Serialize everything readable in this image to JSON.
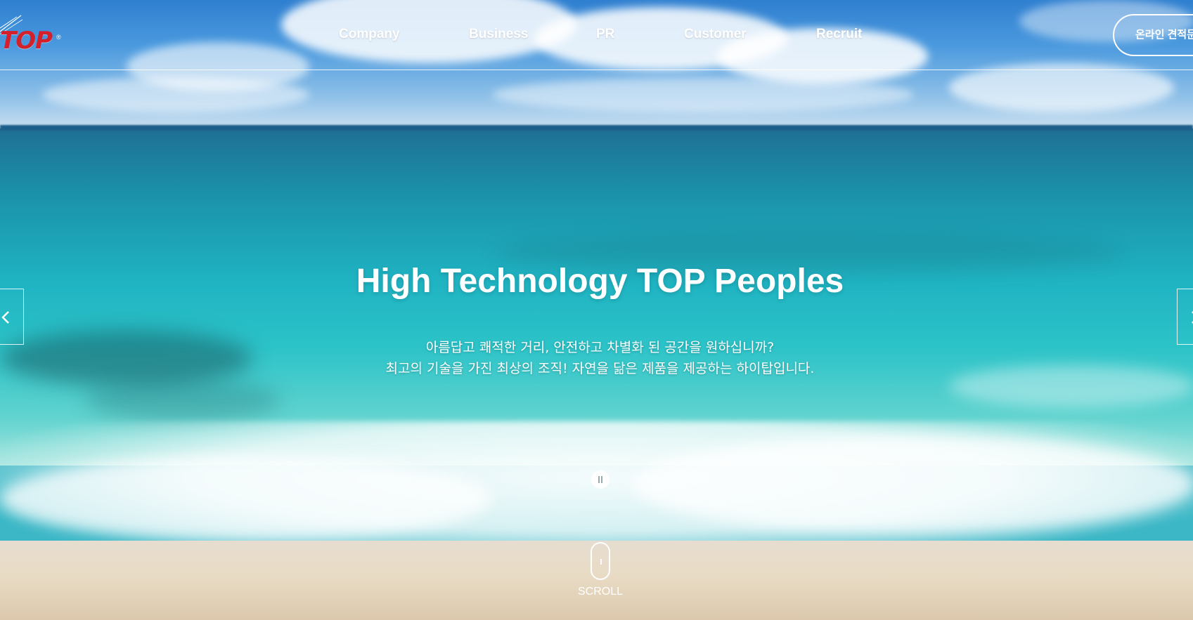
{
  "header": {
    "logo_text": "TOP",
    "logo_mark": "®",
    "nav": [
      {
        "label": "Company"
      },
      {
        "label": "Business"
      },
      {
        "label": "PR"
      },
      {
        "label": "Customer"
      },
      {
        "label": "Recruit"
      }
    ],
    "quote_button_label": "온라인 견적문의"
  },
  "hero": {
    "title": "High Technology TOP Peoples",
    "subtitle_line1": "아름답고 쾌적한 거리, 안전하고 차별화 된 공간을 원하십니까?",
    "subtitle_line2": "최고의 기술을 가진 최상의 조직! 자연을 닮은 제품을 제공하는 하이탑입니다."
  },
  "slider": {
    "prev_icon": "chevron-left-icon",
    "next_icon": "chevron-right-icon",
    "pause_icon": "pause-icon"
  },
  "scroll": {
    "label": "SCROLL",
    "icon": "mouse-icon"
  },
  "colors": {
    "logo_red": "#d4202a",
    "text_white": "#ffffff"
  }
}
